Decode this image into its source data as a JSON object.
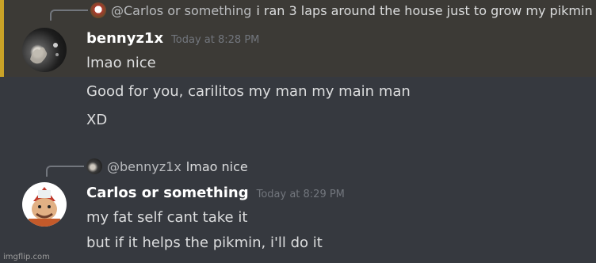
{
  "messages": [
    {
      "reply": {
        "mention": "@Carlos or something",
        "text": "i ran 3 laps around the house just to grow my pikmin"
      },
      "username": "bennyz1x",
      "timestamp": "Today at 8:28 PM",
      "lines": [
        "lmao nice",
        "Good for you, carilitos my man my main man",
        "XD"
      ],
      "highlight_color": "#c9a227"
    },
    {
      "reply": {
        "mention": "@bennyz1x",
        "text": "lmao nice"
      },
      "username": "Carlos or something",
      "timestamp": "Today at 8:29 PM",
      "lines": [
        "my fat self cant take it",
        "but if it helps the pikmin, i'll do it"
      ]
    }
  ],
  "watermark": "imgflip.com"
}
